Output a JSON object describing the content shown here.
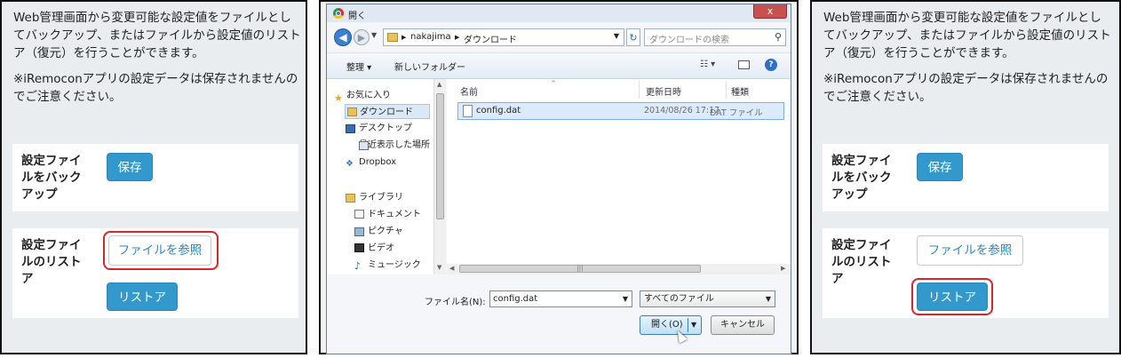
{
  "left_panel": {
    "intro": "Web管理画面から変更可能な設定値をファイルとしてバックアップ、またはファイルから設定値のリストア（復元）を行うことができます。",
    "note": "※iRemoconアプリの設定データは保存されませんのでご注意ください。",
    "backup_card": {
      "label": "設定ファイルをバックアップ",
      "save_button": "保存"
    },
    "restore_card": {
      "label": "設定ファイルのリストア",
      "browse_button": "ファイルを参照",
      "restore_button": "リストア"
    }
  },
  "dialog": {
    "title": "開く",
    "close_glyph": "x",
    "address": {
      "crumbs": [
        "nakajima",
        "ダウンロード"
      ]
    },
    "search_placeholder": "ダウンロードの検索",
    "toolbar": {
      "organize": "整理 ▾",
      "new_folder": "新しいフォルダー",
      "view_glyph": "☷ ▾"
    },
    "nav": {
      "favorites_header": "お気に入り",
      "favorites": [
        "ダウンロード",
        "デスクトップ",
        "最近表示した場所",
        "Dropbox"
      ],
      "libraries_header": "ライブラリ",
      "libraries": [
        "ドキュメント",
        "ピクチャ",
        "ビデオ",
        "ミュージック"
      ],
      "selected": "ダウンロード"
    },
    "columns": {
      "name": "名前",
      "modified": "更新日時",
      "type": "種類"
    },
    "files": [
      {
        "name": "config.dat",
        "modified": "2014/08/26 17:17",
        "type": "DAT ファイル"
      }
    ],
    "filename_label": "ファイル名(N):",
    "filename_value": "config.dat",
    "filetype_value": "すべてのファイル",
    "open_button": "開く(O)",
    "cancel_button": "キャンセル"
  },
  "right_panel": {
    "intro": "Web管理画面から変更可能な設定値をファイルとしてバックアップ、またはファイルから設定値のリストア（復元）を行うことができます。",
    "note": "※iRemoconアプリの設定データは保存されませんのでご注意ください。",
    "backup_card": {
      "label": "設定ファイルをバックアップ",
      "save_button": "保存"
    },
    "restore_card": {
      "label": "設定ファイルのリストア",
      "browse_button": "ファイルを参照",
      "restore_button": "リストア"
    }
  },
  "colors": {
    "accent_blue": "#3399cc",
    "highlight_red": "#d9232d",
    "panel_bg": "#e9edf0"
  }
}
